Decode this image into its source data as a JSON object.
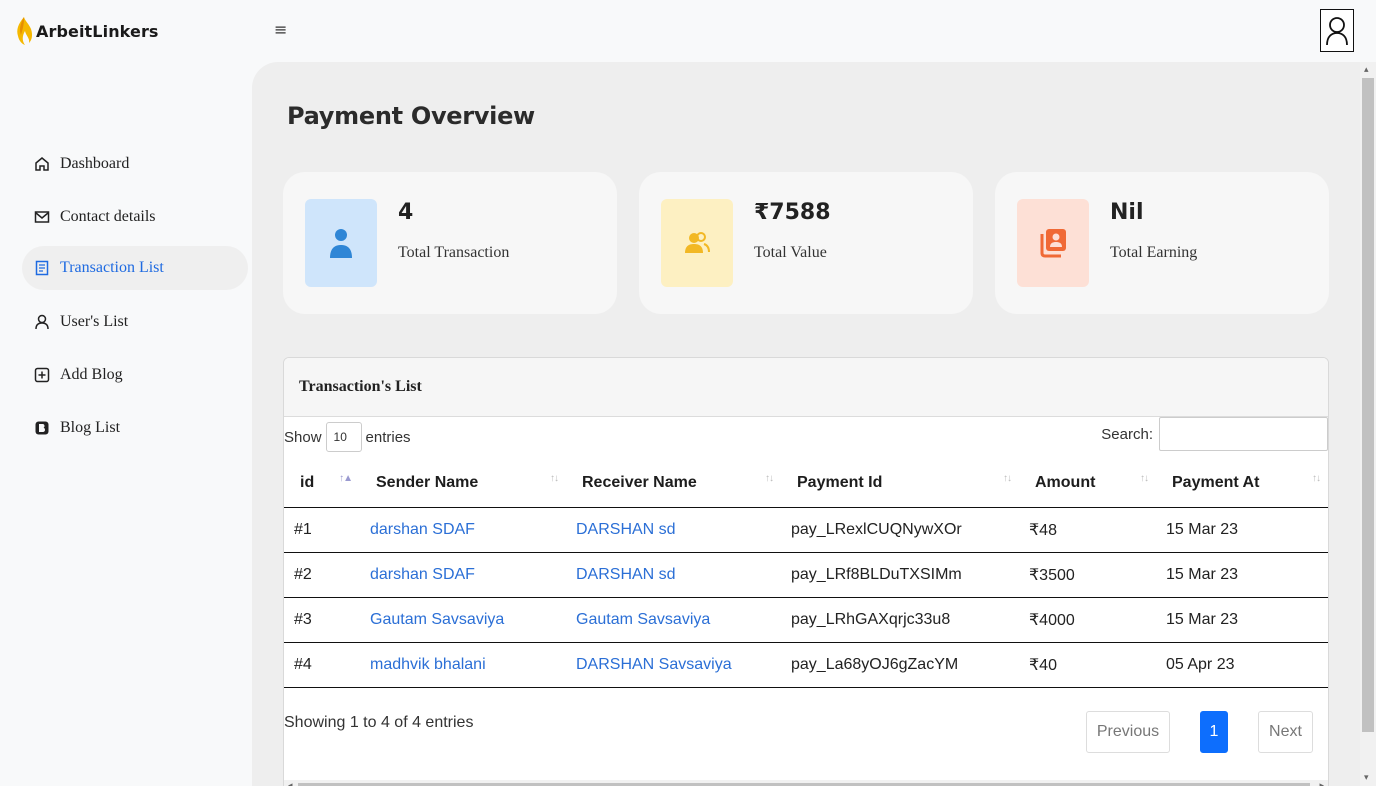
{
  "app": {
    "name": "ArbeitLinkers"
  },
  "sidebar": {
    "items": [
      {
        "label": "Dashboard",
        "icon": "home-icon"
      },
      {
        "label": "Contact details",
        "icon": "mail-icon"
      },
      {
        "label": "Transaction List",
        "icon": "document-icon",
        "active": true
      },
      {
        "label": "User's List",
        "icon": "user-icon"
      },
      {
        "label": "Add Blog",
        "icon": "plus-square-icon"
      },
      {
        "label": "Blog List",
        "icon": "blog-icon"
      }
    ]
  },
  "main": {
    "title": "Payment Overview",
    "cards": [
      {
        "value": "4",
        "label": "Total Transaction",
        "icon": "user-icon",
        "bg": "#cfe5fb",
        "fg": "#2f86d6"
      },
      {
        "value": "₹7588",
        "label": "Total Value",
        "icon": "users-icon",
        "bg": "#fdf0c2",
        "fg": "#f2b824"
      },
      {
        "value": "Nil",
        "label": "Total Earning",
        "icon": "contact-book-icon",
        "bg": "#fde0d6",
        "fg": "#f06935"
      }
    ]
  },
  "table_panel": {
    "title": "Transaction's List",
    "show_label": "Show",
    "entries_value": "10",
    "entries_label": "entries",
    "search_label": "Search:",
    "search_value": "",
    "columns": [
      "id",
      "Sender Name",
      "Receiver Name",
      "Payment Id",
      "Amount",
      "Payment At"
    ],
    "rows": [
      {
        "id": "#1",
        "sender": "darshan SDAF",
        "receiver": "DARSHAN sd",
        "payment_id": "pay_LRexlCUQNywXOr",
        "amount": "₹48",
        "date": "15 Mar 23"
      },
      {
        "id": "#2",
        "sender": "darshan SDAF",
        "receiver": "DARSHAN sd",
        "payment_id": "pay_LRf8BLDuTXSIMm",
        "amount": "₹3500",
        "date": "15 Mar 23"
      },
      {
        "id": "#3",
        "sender": "Gautam Savsaviya",
        "receiver": "Gautam Savsaviya",
        "payment_id": "pay_LRhGAXqrjc33u8",
        "amount": "₹4000",
        "date": "15 Mar 23"
      },
      {
        "id": "#4",
        "sender": "madhvik bhalani",
        "receiver": "DARSHAN Savsaviya",
        "payment_id": "pay_La68yOJ6gZacYM",
        "amount": "₹40",
        "date": "05 Apr 23"
      }
    ],
    "info": "Showing 1 to 4 of 4 entries",
    "pagination": {
      "previous": "Previous",
      "current": "1",
      "next": "Next"
    }
  },
  "colors": {
    "accent": "#0d6efd",
    "link": "#2b6fd6",
    "active_nav": "#1e6ae1"
  }
}
